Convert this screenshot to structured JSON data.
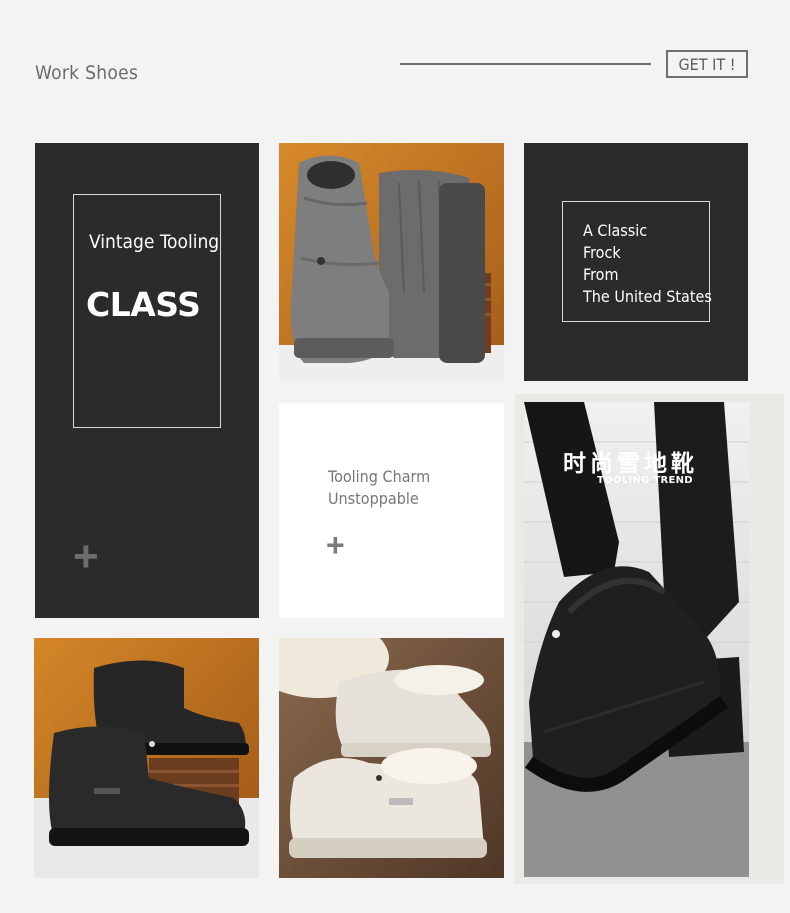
{
  "header": {
    "title": "Work Shoes",
    "cta_label": "GET IT !"
  },
  "panel_left": {
    "heading": "Vintage Tooling",
    "big_text": "CLASS"
  },
  "panel_right": {
    "lines": [
      "A Classic",
      "Frock",
      "From",
      "The United States"
    ]
  },
  "panel_center": {
    "lines": [
      "Tooling Charm",
      "Unstoppable"
    ]
  },
  "promo_photo": {
    "cn_title": "时尚雪地靴",
    "en_subtitle": "TOOLING TREND"
  },
  "colors": {
    "dark_panel": "#2b2b2b",
    "page_bg": "#f3f3f3",
    "text_gray": "#6b6b6b"
  }
}
